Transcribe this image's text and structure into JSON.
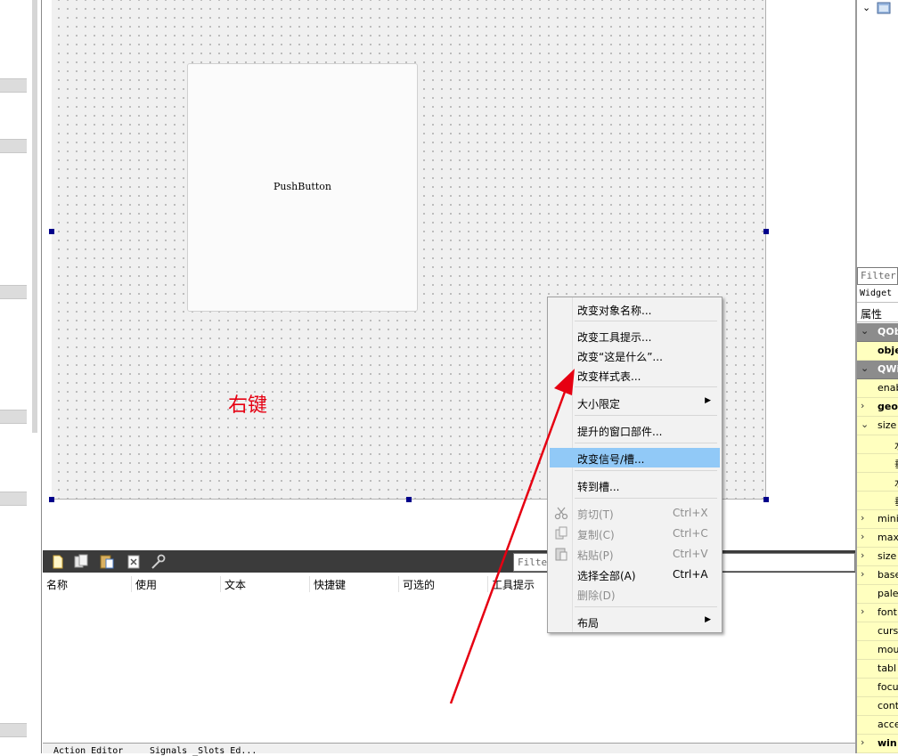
{
  "annotation": {
    "text": "右键",
    "color": "#e60012"
  },
  "form": {
    "pushbutton_label": "PushButton"
  },
  "context_menu": {
    "items": [
      {
        "label": "改变对象名称..."
      },
      {
        "label": "改变工具提示..."
      },
      {
        "label": "改变“这是什么”..."
      },
      {
        "label": "改变样式表..."
      },
      {
        "label": "大小限定",
        "submenu": true
      },
      {
        "label": "提升的窗口部件..."
      },
      {
        "label": "改变信号/槽...",
        "highlighted": true
      },
      {
        "label": "转到槽..."
      },
      {
        "label": "剪切(T)",
        "shortcut": "Ctrl+X",
        "disabled": true,
        "icon": "scissors-icon"
      },
      {
        "label": "复制(C)",
        "shortcut": "Ctrl+C",
        "disabled": true,
        "icon": "copy-icon"
      },
      {
        "label": "粘贴(P)",
        "shortcut": "Ctrl+V",
        "disabled": true,
        "icon": "paste-icon"
      },
      {
        "label": "选择全部(A)",
        "shortcut": "Ctrl+A"
      },
      {
        "label": "删除(D)",
        "disabled": true
      },
      {
        "label": "布局",
        "submenu": true
      }
    ],
    "highlight_color": "#91c9f7"
  },
  "action_editor": {
    "toolbar_icons": [
      "new-action-icon",
      "copy-action-icon",
      "paste-action-icon",
      "delete-action-icon",
      "configure-icon"
    ],
    "filter_placeholder": "Filter",
    "columns": [
      "名称",
      "使用",
      "文本",
      "快捷键",
      "可选的",
      "工具提示"
    ],
    "tabs": [
      "Action Editor",
      "Signals _Slots Ed..."
    ]
  },
  "property_editor": {
    "filter_placeholder": "Filter",
    "class_label": "Widget",
    "header": "属性",
    "rows": [
      {
        "text": "QOb",
        "type": "group"
      },
      {
        "text": "obje",
        "bold": true
      },
      {
        "text": "QWi",
        "type": "group"
      },
      {
        "text": "enab"
      },
      {
        "text": "geo",
        "bold": true,
        "arrow": "›"
      },
      {
        "text": "size",
        "arrow": "⌄"
      },
      {
        "text": "水",
        "sub": true
      },
      {
        "text": "垂",
        "sub": true
      },
      {
        "text": "水",
        "sub": true
      },
      {
        "text": "垂",
        "sub": true
      },
      {
        "text": "mini",
        "arrow": "›"
      },
      {
        "text": "max",
        "arrow": "›"
      },
      {
        "text": "size",
        "arrow": "›"
      },
      {
        "text": "base",
        "arrow": "›"
      },
      {
        "text": "pale"
      },
      {
        "text": "font",
        "arrow": "›"
      },
      {
        "text": "curs"
      },
      {
        "text": "mou"
      },
      {
        "text": "tabl"
      },
      {
        "text": "focu"
      },
      {
        "text": "cont"
      },
      {
        "text": "acce"
      },
      {
        "text": "win",
        "bold": true,
        "arrow": "›"
      }
    ]
  }
}
